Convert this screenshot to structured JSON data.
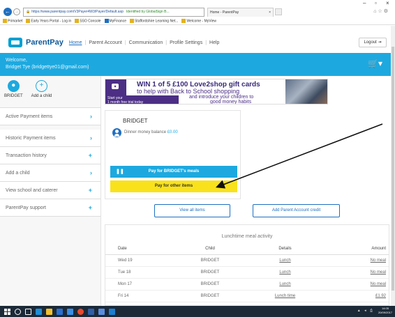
{
  "browser": {
    "url": "https://www.parentpay.com/V3Payer4W3/Payer/Default.asp",
    "verified_label": "Identified by GlobalSign B...",
    "tab_title": "Home - ParentPay",
    "window_controls": [
      "–",
      "▫",
      "×"
    ],
    "favourites": [
      "Primarket",
      "Early Years Portal - Log in",
      "SSO Console",
      "MyFinance",
      "Staffordshire Learning Net...",
      "Welcome - MyView"
    ]
  },
  "header": {
    "brand": "ParentPay",
    "nav": [
      "Home",
      "Parent Account",
      "Communication",
      "Profile Settings",
      "Help"
    ],
    "logout_label": "Logout"
  },
  "welcome": {
    "line1": "Welcome,",
    "line2": "Bridget Tye (bridgettye01@gmail.com)"
  },
  "sidebar": {
    "child_name": "BRIDGET",
    "add_child_label": "Add a child",
    "items": [
      {
        "label": "Active Payment items",
        "icon": "›"
      },
      {
        "label": "Historic Payment items",
        "icon": "›"
      },
      {
        "label": "Transaction history",
        "icon": "+"
      },
      {
        "label": "Add a child",
        "icon": "›"
      },
      {
        "label": "View school and caterer",
        "icon": "+"
      },
      {
        "label": "ParentPay support",
        "icon": "+"
      }
    ]
  },
  "banner": {
    "headline1": "WIN 1 of 5 £100 Love2shop gift cards",
    "headline2": "to help with Back to School shopping",
    "line3": "and introduce your children to",
    "line4": "good money habits",
    "start_line1": "Start your",
    "start_line2": "1 month free trial today"
  },
  "child_card": {
    "name": "BRIDGET",
    "balance_label": "Dinner money balance",
    "balance_value": "£0.00",
    "meals_button": "Pay for BRIDGET's meals",
    "other_button": "Pay for other items"
  },
  "actions": {
    "view_all": "View all items",
    "add_credit": "Add Parent Account credit"
  },
  "activity": {
    "title": "Lunchtime meal activity",
    "columns": [
      "Date",
      "Child",
      "Details",
      "Amount"
    ],
    "rows": [
      [
        "Wed 19",
        "BRIDGET",
        "Lunch",
        "No meal"
      ],
      [
        "Tue 18",
        "BRIDGET",
        "Lunch",
        "No meal"
      ],
      [
        "Mon 17",
        "BRIDGET",
        "Lunch",
        "No meal"
      ],
      [
        "Fri 14",
        "BRIDGET",
        "Lunch time",
        "£1.92"
      ]
    ]
  },
  "taskbar": {
    "time": "14:05",
    "date": "20/09/2017"
  },
  "colors": {
    "brand_blue": "#1da9df",
    "dark_blue": "#1f6fc1",
    "yellow_button": "#f9e21b",
    "banner_purple": "#4c2f85"
  }
}
